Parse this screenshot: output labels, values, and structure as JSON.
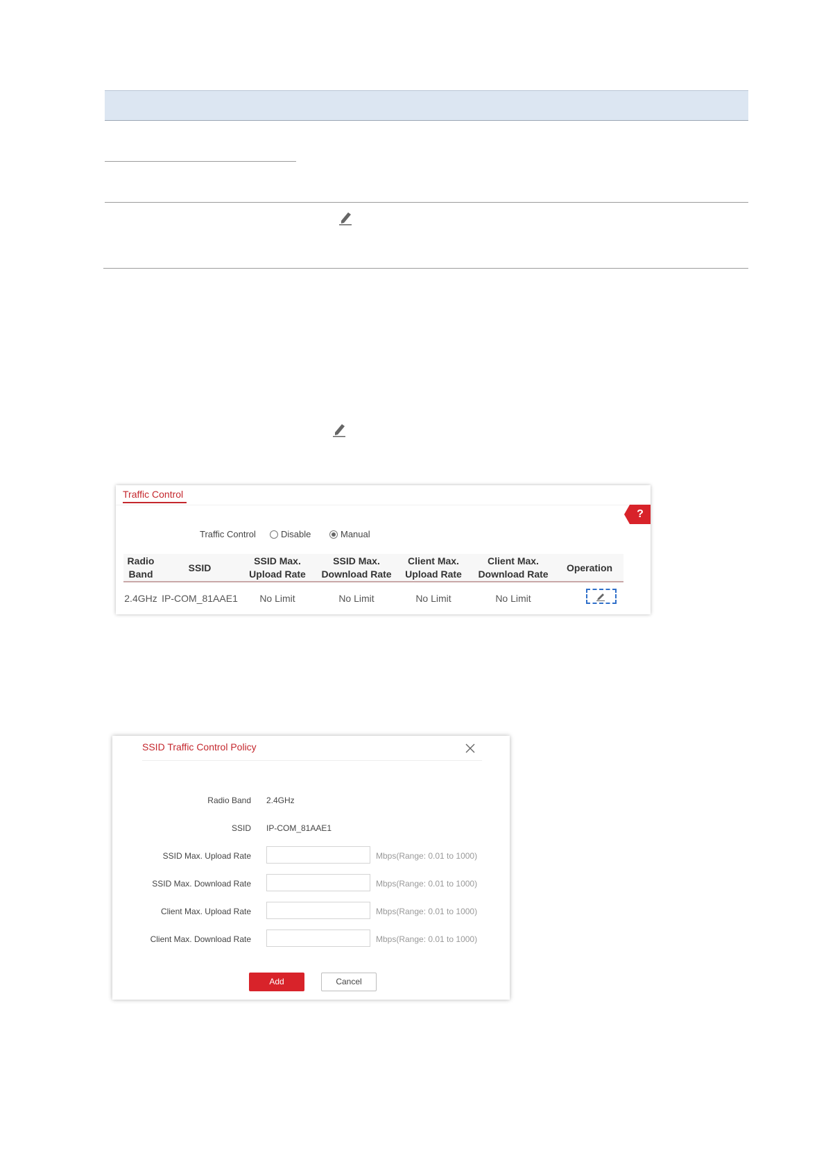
{
  "traffic_control_panel": {
    "tab_label": "Traffic Control",
    "help_label": "?",
    "control_label": "Traffic Control",
    "options": [
      {
        "label": "Disable",
        "selected": false
      },
      {
        "label": "Manual",
        "selected": true
      }
    ],
    "columns": [
      {
        "line1": "Radio",
        "line2": "Band"
      },
      {
        "line1": "SSID",
        "line2": ""
      },
      {
        "line1": "SSID Max.",
        "line2": "Upload Rate"
      },
      {
        "line1": "SSID Max.",
        "line2": "Download Rate"
      },
      {
        "line1": "Client Max.",
        "line2": "Upload Rate"
      },
      {
        "line1": "Client Max.",
        "line2": "Download Rate"
      },
      {
        "line1": "Operation",
        "line2": ""
      }
    ],
    "rows": [
      {
        "radio_band": "2.4GHz",
        "ssid": "IP-COM_81AAE1",
        "ssid_up": "No Limit",
        "ssid_down": "No Limit",
        "client_up": "No Limit",
        "client_down": "No Limit"
      }
    ]
  },
  "dialog": {
    "title": "SSID Traffic Control Policy",
    "fields": {
      "radio_band": {
        "label": "Radio Band",
        "value": "2.4GHz"
      },
      "ssid": {
        "label": "SSID",
        "value": "IP-COM_81AAE1"
      },
      "ssid_up": {
        "label": "SSID Max. Upload Rate",
        "value": "",
        "hint": "Mbps(Range: 0.01 to 1000)"
      },
      "ssid_down": {
        "label": "SSID Max. Download Rate",
        "value": "",
        "hint": "Mbps(Range: 0.01 to 1000)"
      },
      "client_up": {
        "label": "Client Max. Upload Rate",
        "value": "",
        "hint": "Mbps(Range: 0.01 to 1000)"
      },
      "client_down": {
        "label": "Client Max. Download Rate",
        "value": "",
        "hint": "Mbps(Range: 0.01 to 1000)"
      }
    },
    "add_label": "Add",
    "cancel_label": "Cancel"
  },
  "colors": {
    "accent": "#c4272d",
    "focus": "#2f6fc9",
    "doc_header": "#dce6f2"
  },
  "icons": [
    "edit-icon",
    "close-icon",
    "help-icon"
  ]
}
